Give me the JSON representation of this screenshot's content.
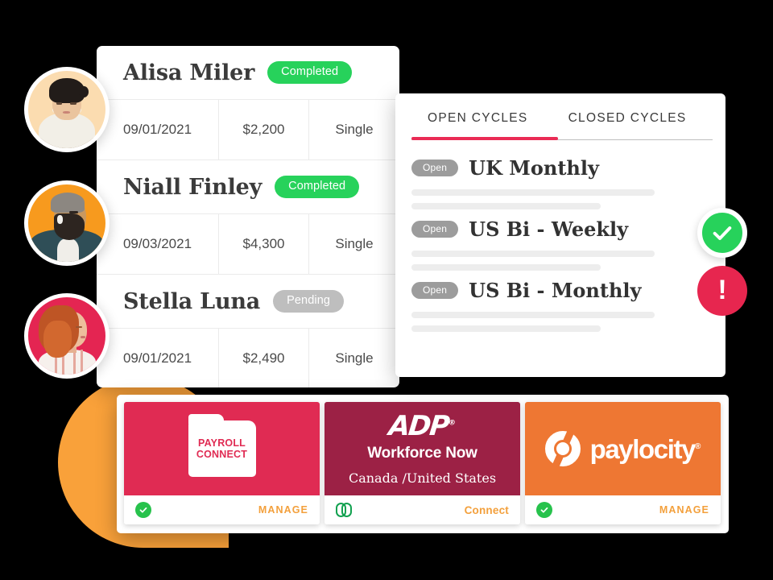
{
  "payroll_table": {
    "rows": [
      {
        "name": "Alisa Miler",
        "status": "Completed",
        "status_type": "completed",
        "date": "09/01/2021",
        "amount": "$2,200",
        "filing": "Single"
      },
      {
        "name": "Niall Finley",
        "status": "Completed",
        "status_type": "completed",
        "date": "09/03/2021",
        "amount": "$4,300",
        "filing": "Single"
      },
      {
        "name": "Stella Luna",
        "status": "Pending",
        "status_type": "pending",
        "date": "09/01/2021",
        "amount": "$2,490",
        "filing": "Single"
      }
    ]
  },
  "cycles_panel": {
    "tabs": [
      {
        "label": "OPEN CYCLES",
        "active": true
      },
      {
        "label": "CLOSED CYCLES",
        "active": false
      }
    ],
    "items": [
      {
        "badge": "Open",
        "name": "UK Monthly"
      },
      {
        "badge": "Open",
        "name": "US Bi - Weekly"
      },
      {
        "badge": "Open",
        "name": "US Bi - Monthly"
      }
    ]
  },
  "floating_badges": [
    {
      "icon": "check-circle-icon",
      "color": "#27D25B"
    },
    {
      "icon": "alert-circle-icon",
      "color": "#E7264F",
      "glyph": "!"
    }
  ],
  "integrations": {
    "cards": [
      {
        "provider": "Payroll Connect",
        "logo_line1": "PAYROLL",
        "logo_line2": "CONNECT",
        "brand_color": "#E02B53",
        "status_icon": "check-circle-icon",
        "action": "MANAGE"
      },
      {
        "provider": "ADP",
        "logo_text": "ADP",
        "logo_mark": "®",
        "title": "Workforce Now",
        "subtitle": "Canada /United States",
        "brand_color": "#9C2145",
        "status_icon": "link-icon",
        "action": "Connect"
      },
      {
        "provider": "Paylocity",
        "logo_text": "paylocity",
        "logo_mark": "®",
        "brand_color": "#EE7733",
        "status_icon": "check-circle-icon",
        "action": "MANAGE"
      }
    ]
  },
  "avatars": [
    {
      "person": "Alisa Miler",
      "bg": "#FBDCB0"
    },
    {
      "person": "Niall Finley",
      "bg": "#F79A1E"
    },
    {
      "person": "Stella Luna",
      "bg": "#E42552"
    }
  ]
}
